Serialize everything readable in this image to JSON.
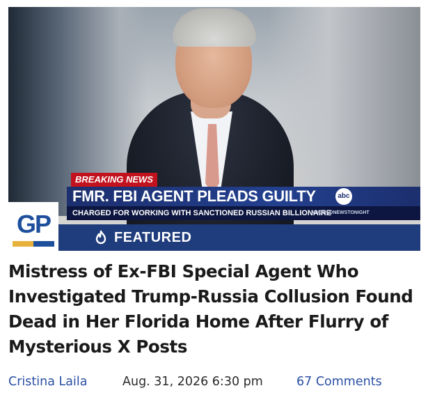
{
  "hero": {
    "breaking_label": "BREAKING NEWS",
    "headline": "FMR. FBI AGENT PLEADS GUILTY",
    "subheadline": "CHARGED FOR WORKING WITH SANCTIONED RUSSIAN BILLIONAIRE",
    "hashtag": "#WORLDNEWSTONIGHT",
    "network": "abc"
  },
  "logo": {
    "text": "GP"
  },
  "featured": {
    "label": "FEATURED",
    "icon": "flame-icon"
  },
  "article": {
    "title": "Mistress of Ex-FBI Special Agent Who Investigated Trump-Russia Collusion Found Dead in Her Florida Home After Flurry of Mysterious X Posts",
    "author": "Cristina Laila",
    "date": "Aug. 31, 2026 6:30 pm",
    "comments": "67 Comments"
  },
  "colors": {
    "brand_blue": "#1f3c7c",
    "link_blue": "#2a4fa3",
    "breaking_red": "#c2121d",
    "accent_gold": "#e7b23c"
  }
}
